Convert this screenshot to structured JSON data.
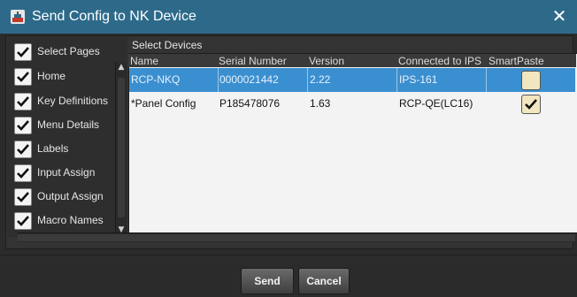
{
  "window": {
    "title": "Send Config to NK Device",
    "close_glyph": "✕",
    "icon": "app-icon"
  },
  "pages": {
    "items": [
      {
        "label": "Select Pages",
        "checked": true
      },
      {
        "label": "Home",
        "checked": true
      },
      {
        "label": "Key Definitions",
        "checked": true
      },
      {
        "label": "Menu Details",
        "checked": true
      },
      {
        "label": "Labels",
        "checked": true
      },
      {
        "label": "Input Assign",
        "checked": true
      },
      {
        "label": "Output Assign",
        "checked": true
      },
      {
        "label": "Macro Names",
        "checked": true
      }
    ]
  },
  "devices": {
    "label": "Select Devices",
    "columns": [
      "Name",
      "Serial Number",
      "Version",
      "Connected to IPS",
      "SmartPaste"
    ],
    "rows": [
      {
        "name": "RCP-NKQ",
        "serial": "0000021442",
        "version": "2.22",
        "connected": "IPS-161",
        "smartpaste": false,
        "selected": true
      },
      {
        "name": "*Panel Config",
        "serial": "P185478076",
        "version": "1.63",
        "connected": "RCP-QE(LC16)",
        "smartpaste": true,
        "selected": false
      }
    ]
  },
  "footer": {
    "send_label": "Send",
    "cancel_label": "Cancel"
  },
  "colors": {
    "titlebar": "#2d6a8a",
    "selection": "#3a8fd0"
  }
}
